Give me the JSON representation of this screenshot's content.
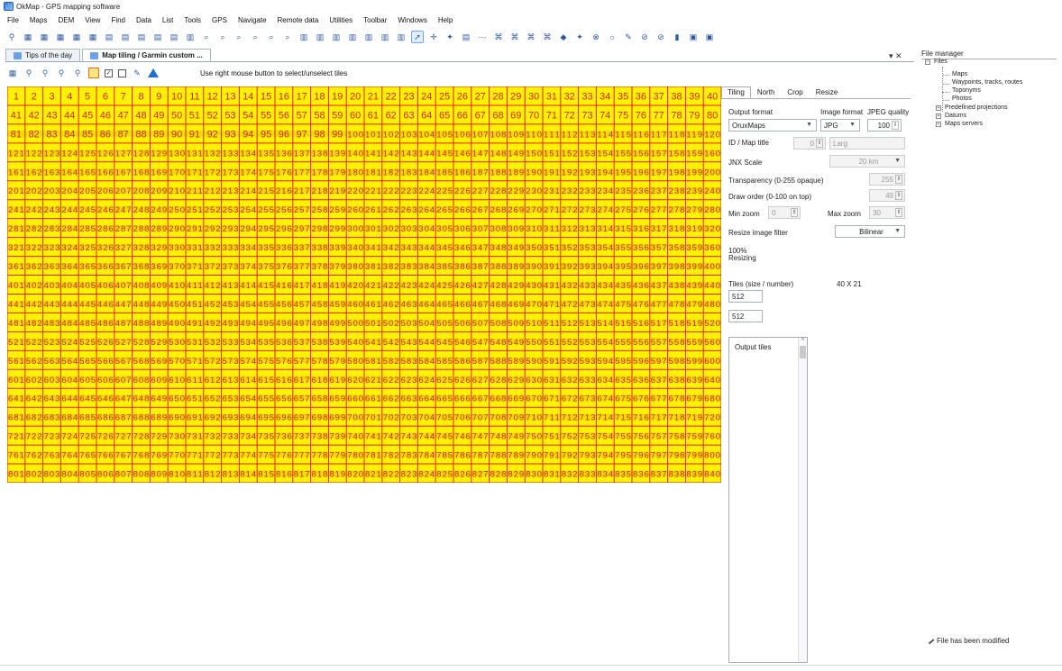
{
  "window": {
    "title": "OkMap - GPS mapping software"
  },
  "menu": [
    "File",
    "Maps",
    "DEM",
    "View",
    "Find",
    "Data",
    "List",
    "Tools",
    "GPS",
    "Navigate",
    "Remote data",
    "Utilities",
    "Toolbar",
    "Windows",
    "Help"
  ],
  "doc_tabs": [
    {
      "label": "Tips of the day",
      "active": false
    },
    {
      "label": "Map tiling / Garmin custom ...",
      "active": true
    }
  ],
  "tabs_controls": "▾ ✕",
  "inner_toolbar": {
    "hint": "Use right mouse button to select/unselect tiles",
    "icons": [
      "map-icon",
      "zoom-in-icon",
      "zoom-out-icon",
      "zoom-fit-icon",
      "zoom-select-icon",
      "grid-select-icon",
      "check-all-icon",
      "uncheck-all-icon",
      "paint-icon",
      "triangle-icon"
    ]
  },
  "tile_grid": {
    "columns": 40,
    "rows": 21,
    "first": 1,
    "last": 840,
    "cell_color": "#fff200",
    "line_color": "#e0221c",
    "text_color": "#d9231c",
    "map_tint": "#6b3a10"
  },
  "panel": {
    "tabs": [
      "Tiling",
      "North",
      "Crop",
      "Resize"
    ],
    "active_tab": "Tiling",
    "output_format_label": "Output format",
    "output_format_value": "OruxMaps",
    "image_format_label": "Image format",
    "image_format_value": "JPG",
    "jpeg_quality_label": "JPEG quality",
    "jpeg_quality_value": "100",
    "id_label": "ID / Map title",
    "id_value": "0",
    "id_title_placeholder": "Larg",
    "jnx_label": "JNX Scale",
    "jnx_value": "20 km",
    "transparency_label": "Transparency (0-255 opaque)",
    "transparency_value": "255",
    "draw_order_label": "Draw order (0-100 on top)",
    "draw_order_value": "49",
    "min_zoom_label": "Min zoom",
    "min_zoom_value": "0",
    "max_zoom_label": "Max zoom",
    "max_zoom_value": "30",
    "resize_filter_label": "Resize image filter",
    "resize_filter_value": "Bilinear",
    "progress_pct": "100%",
    "progress_text": "Resizing",
    "tiles_label": "Tiles (size / number)",
    "tiles_count": "40  X  21",
    "tile_width": "512",
    "tile_height": "512",
    "output_tiles_label": "Output tiles"
  },
  "file_manager": {
    "title": "File manager",
    "root": "Files",
    "children": [
      "Maps",
      "Waypoints, tracks, routes",
      "Toponyms",
      "Photos",
      "Predefined projections",
      "Datums",
      "Maps servers"
    ],
    "status": "File has been modified"
  }
}
